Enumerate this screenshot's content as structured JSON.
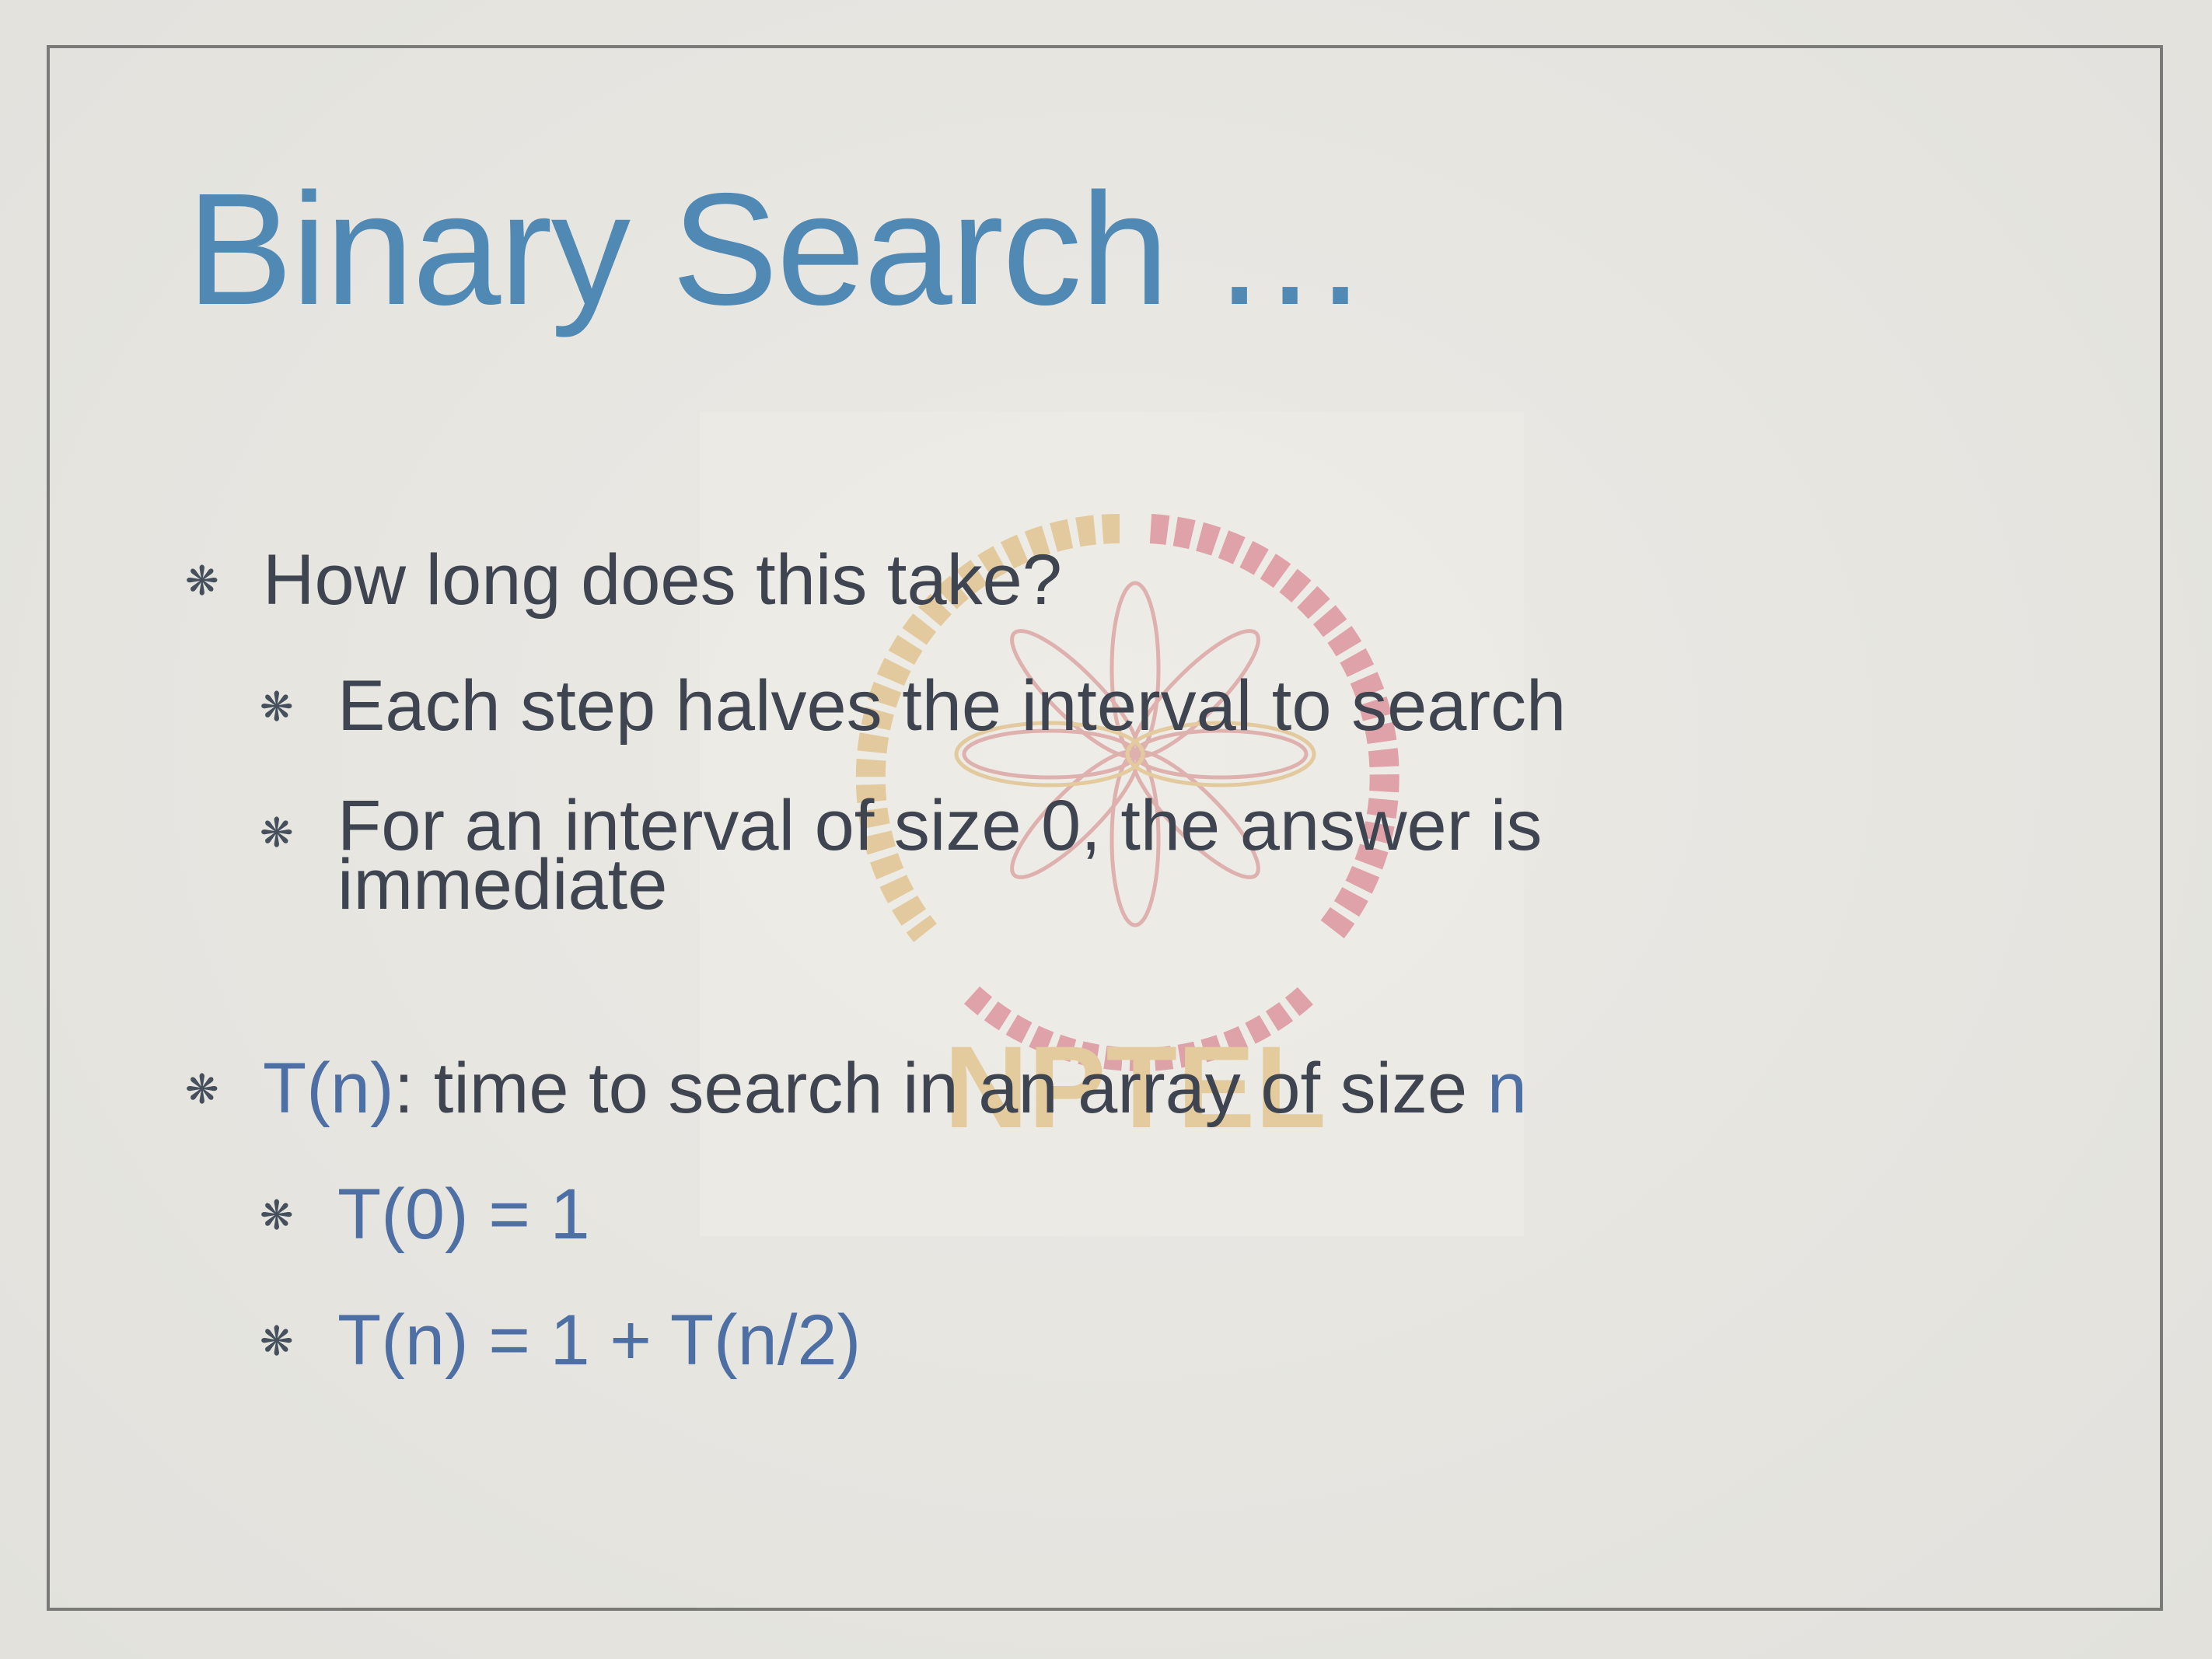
{
  "slide": {
    "title": "Binary Search …",
    "bullet_marker": "❋",
    "bullets": [
      {
        "text": "How long does this take?"
      },
      {
        "text": "Each step halves the interval to search"
      },
      {
        "text": "For an interval of size 0, the answer is immediate"
      },
      {
        "prefix": "T(n)",
        "middle": ": time to search in an array of size ",
        "suffix": "n"
      },
      {
        "text": "T(0) = 1"
      },
      {
        "text": "T(n) = 1 + T(n/2)"
      }
    ]
  },
  "watermark": {
    "text": "NPTEL"
  },
  "colors": {
    "title": "#5089b3",
    "body_text": "#3f4550",
    "math_text": "#4e6fa3",
    "background": "#e6e5e0",
    "frame": "#7a7a78"
  }
}
